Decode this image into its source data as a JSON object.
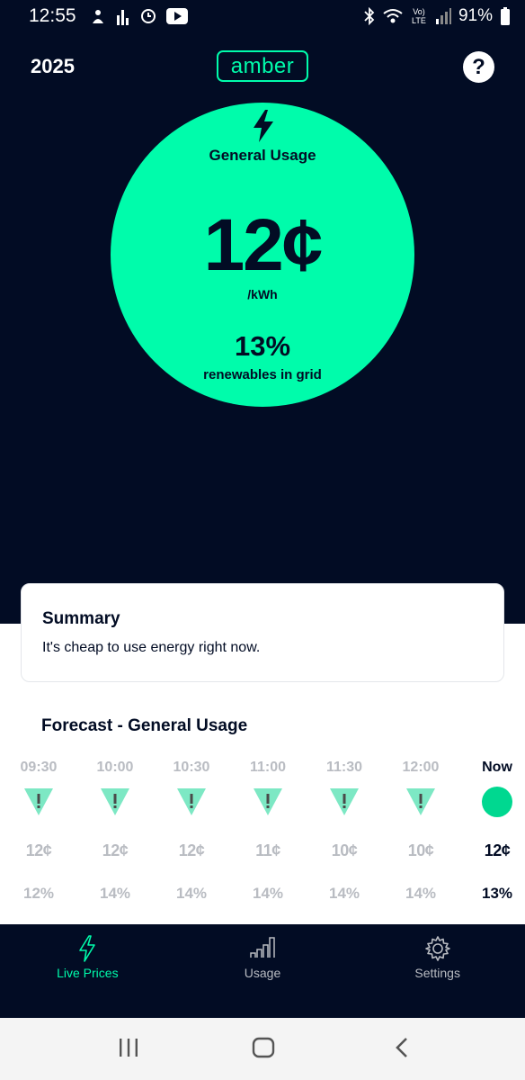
{
  "status_bar": {
    "time": "12:55",
    "battery": "91%",
    "network": "Vo) LTE"
  },
  "header": {
    "year": "2025",
    "logo_text": "amber",
    "help_label": "?"
  },
  "price_card": {
    "channel": "General Usage",
    "price": "12¢",
    "unit": "/kWh",
    "renewables": "13%",
    "renewables_label": "renewables in grid",
    "color": "#00fcab"
  },
  "summary": {
    "title": "Summary",
    "text": "It's cheap to use energy right now."
  },
  "forecast": {
    "title": "Forecast - General Usage",
    "columns": [
      {
        "time": "09:30",
        "price": "12¢",
        "renewables": "12%",
        "icon": "warning-triangle-icon"
      },
      {
        "time": "10:00",
        "price": "12¢",
        "renewables": "14%",
        "icon": "warning-triangle-icon"
      },
      {
        "time": "10:30",
        "price": "12¢",
        "renewables": "14%",
        "icon": "warning-triangle-icon"
      },
      {
        "time": "11:00",
        "price": "11¢",
        "renewables": "14%",
        "icon": "warning-triangle-icon"
      },
      {
        "time": "11:30",
        "price": "10¢",
        "renewables": "14%",
        "icon": "warning-triangle-icon"
      },
      {
        "time": "12:00",
        "price": "10¢",
        "renewables": "14%",
        "icon": "warning-triangle-icon"
      },
      {
        "time": "Now",
        "price": "12¢",
        "renewables": "13%",
        "icon": "status-dot-icon"
      }
    ]
  },
  "bottom_nav": {
    "items": [
      {
        "label": "Live Prices",
        "icon": "bolt-icon",
        "active": true
      },
      {
        "label": "Usage",
        "icon": "bar-chart-icon",
        "active": false
      },
      {
        "label": "Settings",
        "icon": "gear-icon",
        "active": false
      }
    ]
  }
}
